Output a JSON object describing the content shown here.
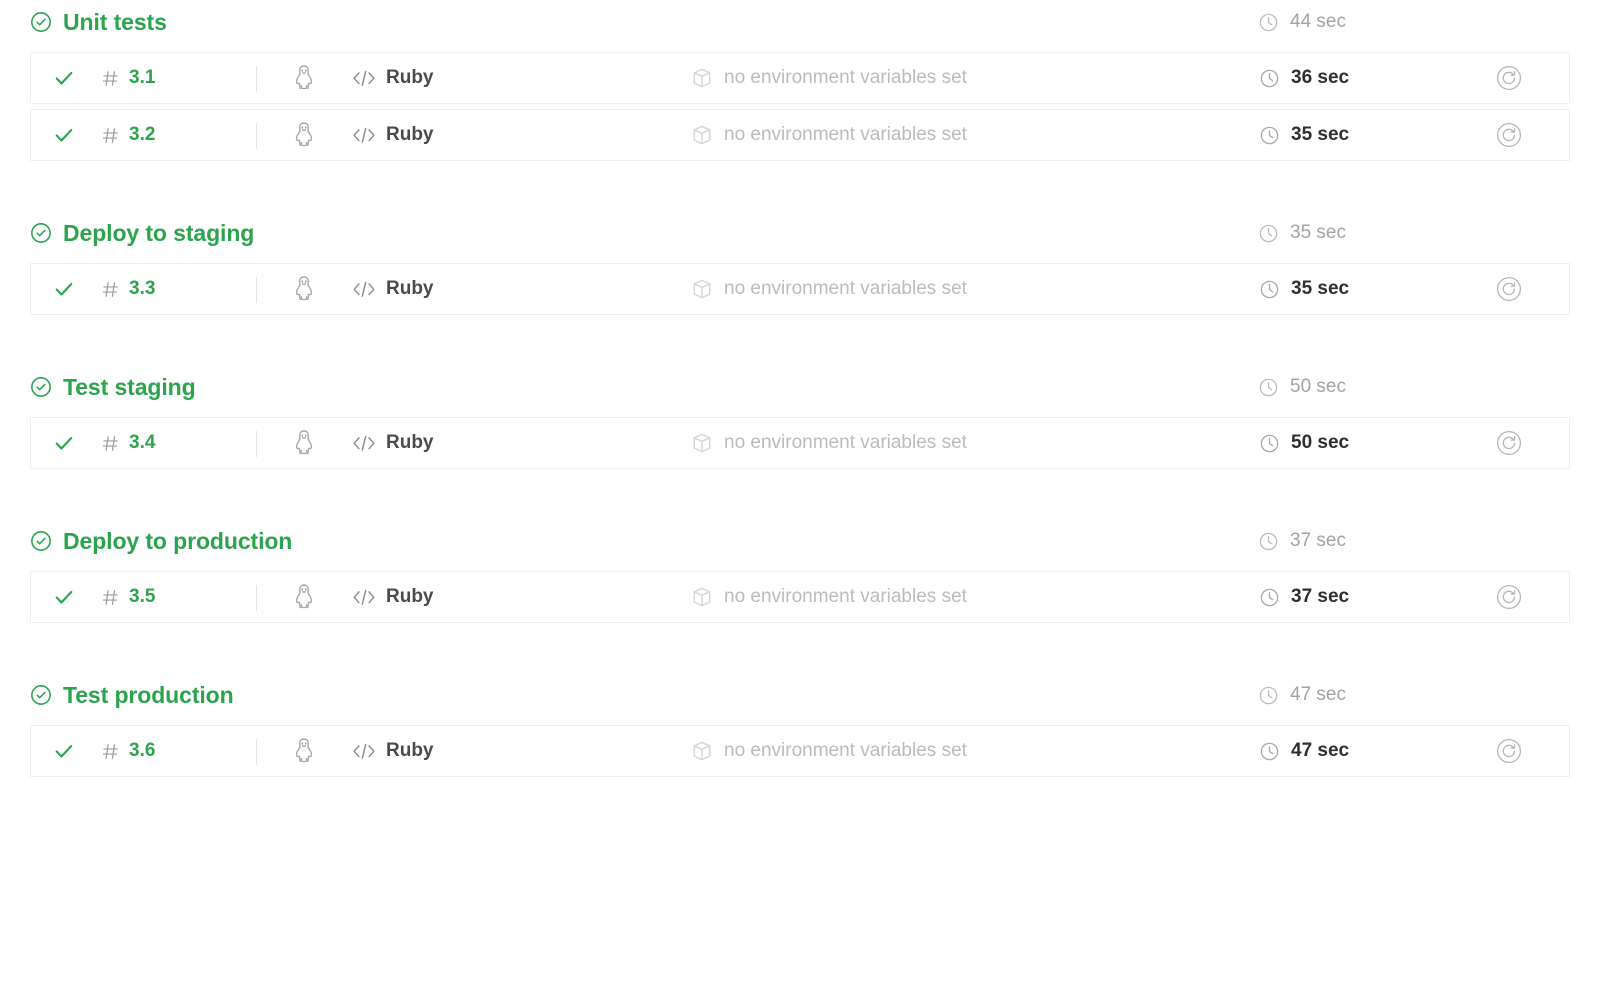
{
  "icons": {
    "stage_status": "check-circle-icon",
    "job_status": "check-icon",
    "hash": "hash-icon",
    "os": "linux-penguin-icon",
    "language": "code-brackets-icon",
    "environment": "cube-icon",
    "duration": "clock-icon",
    "retry": "retry-icon"
  },
  "stages": [
    {
      "name": "Unit tests",
      "duration": "44 sec",
      "jobs": [
        {
          "number": "3.1",
          "os": "Linux",
          "language": "Ruby",
          "environment": "no environment variables set",
          "duration": "36 sec"
        },
        {
          "number": "3.2",
          "os": "Linux",
          "language": "Ruby",
          "environment": "no environment variables set",
          "duration": "35 sec"
        }
      ]
    },
    {
      "name": "Deploy to staging",
      "duration": "35 sec",
      "jobs": [
        {
          "number": "3.3",
          "os": "Linux",
          "language": "Ruby",
          "environment": "no environment variables set",
          "duration": "35 sec"
        }
      ]
    },
    {
      "name": "Test staging",
      "duration": "50 sec",
      "jobs": [
        {
          "number": "3.4",
          "os": "Linux",
          "language": "Ruby",
          "environment": "no environment variables set",
          "duration": "50 sec"
        }
      ]
    },
    {
      "name": "Deploy to production",
      "duration": "37 sec",
      "jobs": [
        {
          "number": "3.5",
          "os": "Linux",
          "language": "Ruby",
          "environment": "no environment variables set",
          "duration": "37 sec"
        }
      ]
    },
    {
      "name": "Test production",
      "duration": "47 sec",
      "jobs": [
        {
          "number": "3.6",
          "os": "Linux",
          "language": "Ruby",
          "environment": "no environment variables set",
          "duration": "47 sec"
        }
      ]
    }
  ],
  "colors": {
    "success_green": "#2ca44e",
    "row_border": "#efefef",
    "muted_text": "#bcbcbc",
    "dark_text": "#2f2f2f"
  }
}
